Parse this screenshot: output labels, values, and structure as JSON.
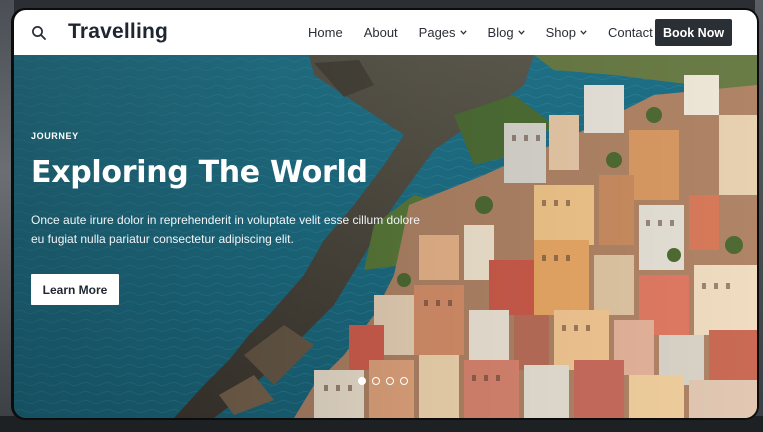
{
  "nav": {
    "brand": "Travelling",
    "search_icon": "search-icon",
    "items": [
      {
        "label": "Home",
        "dropdown": false
      },
      {
        "label": "About",
        "dropdown": false
      },
      {
        "label": "Pages",
        "dropdown": true
      },
      {
        "label": "Blog",
        "dropdown": true
      },
      {
        "label": "Shop",
        "dropdown": true
      },
      {
        "label": "Contact",
        "dropdown": false
      }
    ],
    "cta": "Book Now"
  },
  "hero": {
    "kicker": "JOURNEY",
    "title": "Exploring The World",
    "description": "Once aute irure dolor in reprehenderit in voluptate velit esse cillum dolore eu fugiat nulla pariatur consectetur adipiscing elit.",
    "button": "Learn More",
    "slides": {
      "count": 4,
      "active": 1
    }
  },
  "colors": {
    "nav_bg": "#ffffff",
    "brand_text": "#1e2630",
    "cta_bg": "#2a2f36",
    "sea": "#1f6e85"
  }
}
